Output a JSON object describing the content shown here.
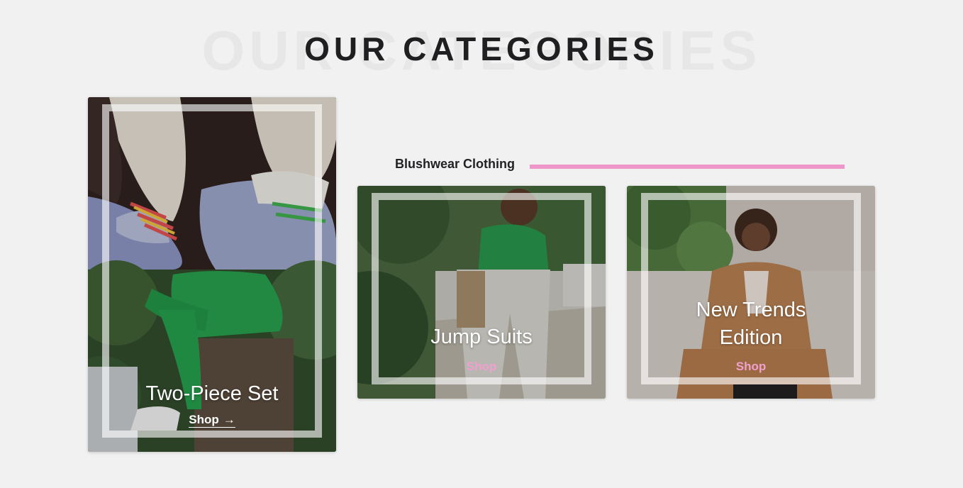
{
  "section": {
    "heading": "OUR CATEGORIES",
    "heading_ghost": "OUR CATEGORIES"
  },
  "brand": {
    "label": "Blushwear Clothing",
    "accent_color": "#ee95c9"
  },
  "categories": [
    {
      "title": "Two-Piece Set",
      "shop_label": "Shop",
      "shop_icon": "arrow-right-icon"
    },
    {
      "title": "Jump Suits",
      "shop_label": "Shop"
    },
    {
      "title": "New Trends Edition",
      "shop_label": "Shop"
    }
  ],
  "colors": {
    "background": "#f1f1f1",
    "heading": "#1f1f22",
    "shop_pink": "#f09fcf"
  }
}
